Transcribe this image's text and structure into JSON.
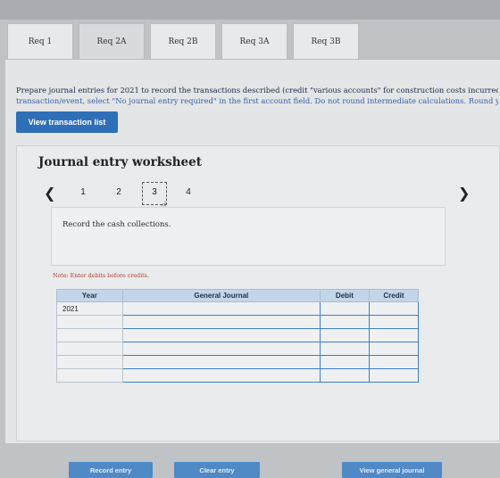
{
  "tabs": [
    {
      "label": "Req 1"
    },
    {
      "label": "Req 2A"
    },
    {
      "label": "Req 2B"
    },
    {
      "label": "Req 3A"
    },
    {
      "label": "Req 3B"
    }
  ],
  "instructions": {
    "line1": "Prepare journal entries for 2021 to record the transactions described (credit \"various accounts\" for construction costs incurred). (If",
    "line2": "transaction/event, select \"No journal entry required\" in the first account field. Do not round intermediate calculations. Round your a"
  },
  "view_transaction_label": "View transaction list",
  "worksheet": {
    "title": "Journal entry worksheet",
    "pages": [
      "1",
      "2",
      "3",
      "4"
    ],
    "current_page": "3",
    "description": "Record the cash collections.",
    "note": "Note: Enter debits before credits.",
    "columns": {
      "year": "Year",
      "journal": "General Journal",
      "debit": "Debit",
      "credit": "Credit"
    },
    "rows": [
      {
        "year": "2021"
      },
      {
        "year": ""
      },
      {
        "year": ""
      },
      {
        "year": ""
      },
      {
        "year": ""
      },
      {
        "year": ""
      }
    ],
    "record_label": "Record entry",
    "clear_label": "Clear entry",
    "view_general_label": "View general journal"
  }
}
